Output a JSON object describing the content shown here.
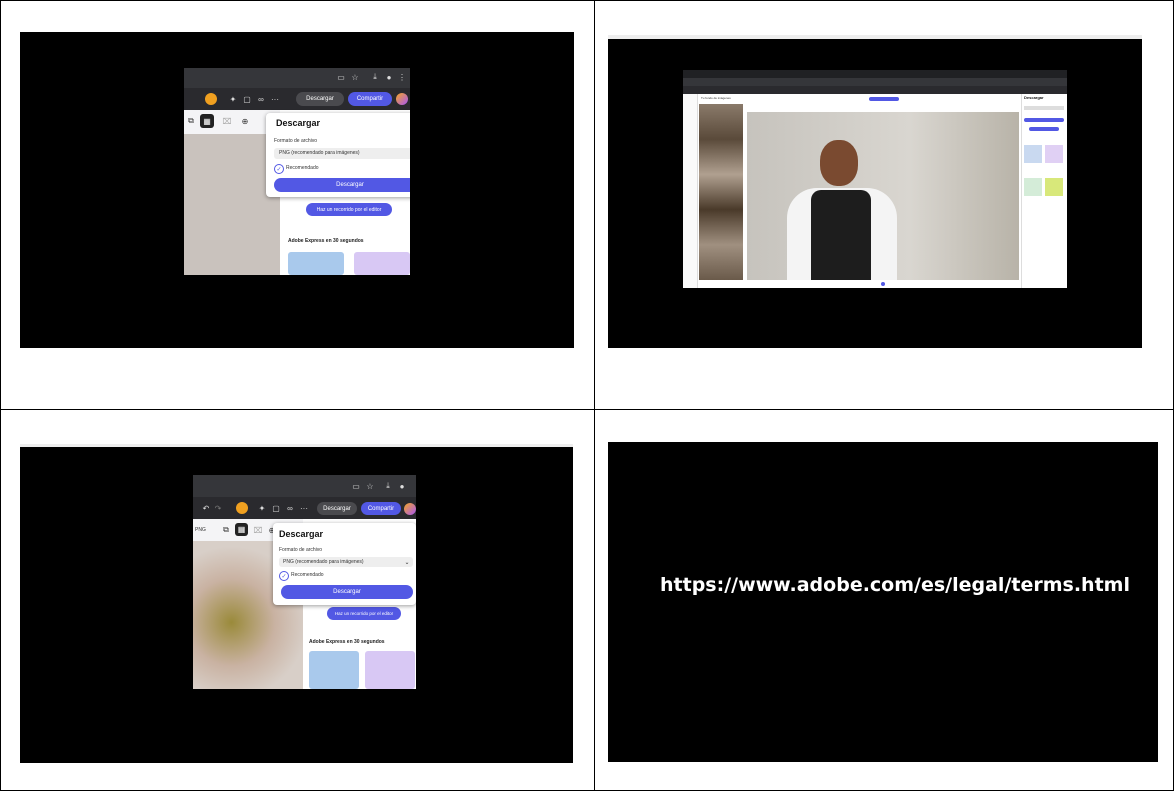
{
  "panel1": {
    "popup_title": "Descargar",
    "format_label": "Formato de archivo",
    "format_value": "PNG (recomendado para imágenes)",
    "recommended": "Recomendado",
    "download_btn": "Descargar",
    "download_top": "Descargar",
    "share_top": "Compartir",
    "tour_btn": "Haz un recorrido por el editor",
    "express_title": "Adobe Express en 30 segundos"
  },
  "panel2": {
    "left_header": "Tu fondo de imágenes",
    "popup_title": "Descargar"
  },
  "panel3": {
    "popup_title": "Descargar",
    "format_label": "Formato de archivo",
    "format_value": "PNG (recomendado para imágenes)",
    "recommended": "Recomendado",
    "download_btn": "Descargar",
    "download_top": "Descargar",
    "share_top": "Compartir",
    "tour_btn": "Haz un recorrido por el editor",
    "express_title": "Adobe Express en 30 segundos",
    "zoom": "PNG"
  },
  "panel4": {
    "url": "https://www.adobe.com/es/legal/terms.html"
  },
  "colors": {
    "accent": "#5258e4",
    "dark": "#2b2b2e",
    "black": "#000000"
  }
}
